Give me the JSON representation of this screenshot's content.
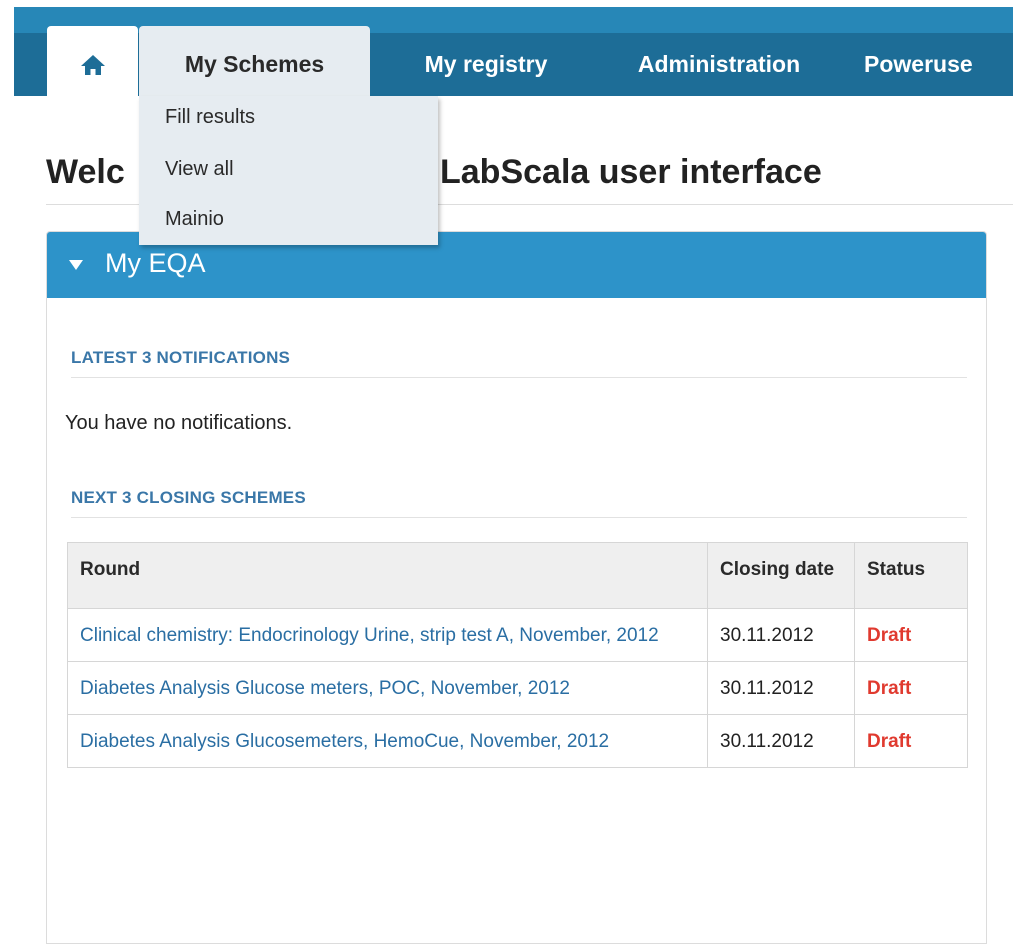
{
  "nav": {
    "home_icon": "home-icon",
    "tabs": [
      {
        "label": "My Schemes"
      },
      {
        "label": "My registry"
      },
      {
        "label": "Administration"
      },
      {
        "label": "Poweruse"
      }
    ],
    "dropdown": [
      "Fill results",
      "View all",
      "Mainio"
    ]
  },
  "page": {
    "title_lead": "Welc",
    "title_tail": "LabScala user interface"
  },
  "panel": {
    "title": "My EQA",
    "notifications_heading": "LATEST 3 NOTIFICATIONS",
    "notifications_empty": "You have no notifications.",
    "closing_heading": "NEXT 3 CLOSING SCHEMES",
    "table": {
      "headers": [
        "Round",
        "Closing date",
        "Status"
      ],
      "rows": [
        {
          "round": "Clinical chemistry: Endocrinology Urine, strip test A, November, 2012",
          "date": "30.11.2012",
          "status": "Draft"
        },
        {
          "round": "Diabetes Analysis Glucose meters, POC, November, 2012",
          "date": "30.11.2012",
          "status": "Draft"
        },
        {
          "round": "Diabetes Analysis Glucosemeters, HemoCue, November, 2012",
          "date": "30.11.2012",
          "status": "Draft"
        }
      ]
    }
  },
  "colors": {
    "nav_bg": "#1d6d97",
    "panel_head": "#2d93c9",
    "link": "#2a6ea3",
    "status_draft": "#e03a2f"
  }
}
